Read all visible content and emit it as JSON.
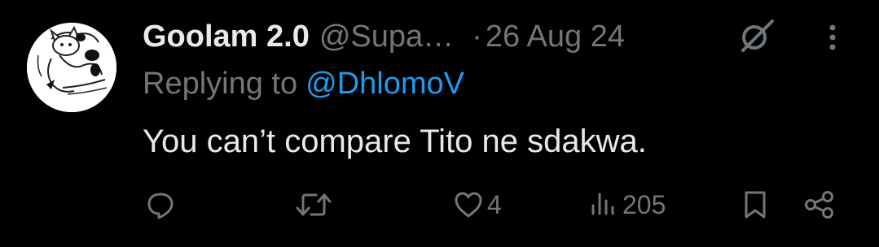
{
  "tweet": {
    "display_name": "Goolam 2.0",
    "handle": "@Supa…",
    "separator": "·",
    "timestamp": "26 Aug 24",
    "reply_prefix": "Replying to",
    "reply_handle": "@DhlomoV",
    "text": "You can’t compare Tito ne sdakwa."
  },
  "actions": {
    "reply_count": "",
    "retweet_count": "",
    "like_count": "4",
    "view_count": "205"
  },
  "icons": {
    "grok": "grok-icon",
    "more": "more-vertical-icon",
    "reply": "reply-icon",
    "retweet": "retweet-icon",
    "like": "heart-icon",
    "views": "views-chart-icon",
    "bookmark": "bookmark-icon",
    "share": "share-icon"
  },
  "colors": {
    "background": "#000000",
    "primary_text": "#e7e9ea",
    "secondary_text": "#71767b",
    "link": "#1d9bf0"
  }
}
